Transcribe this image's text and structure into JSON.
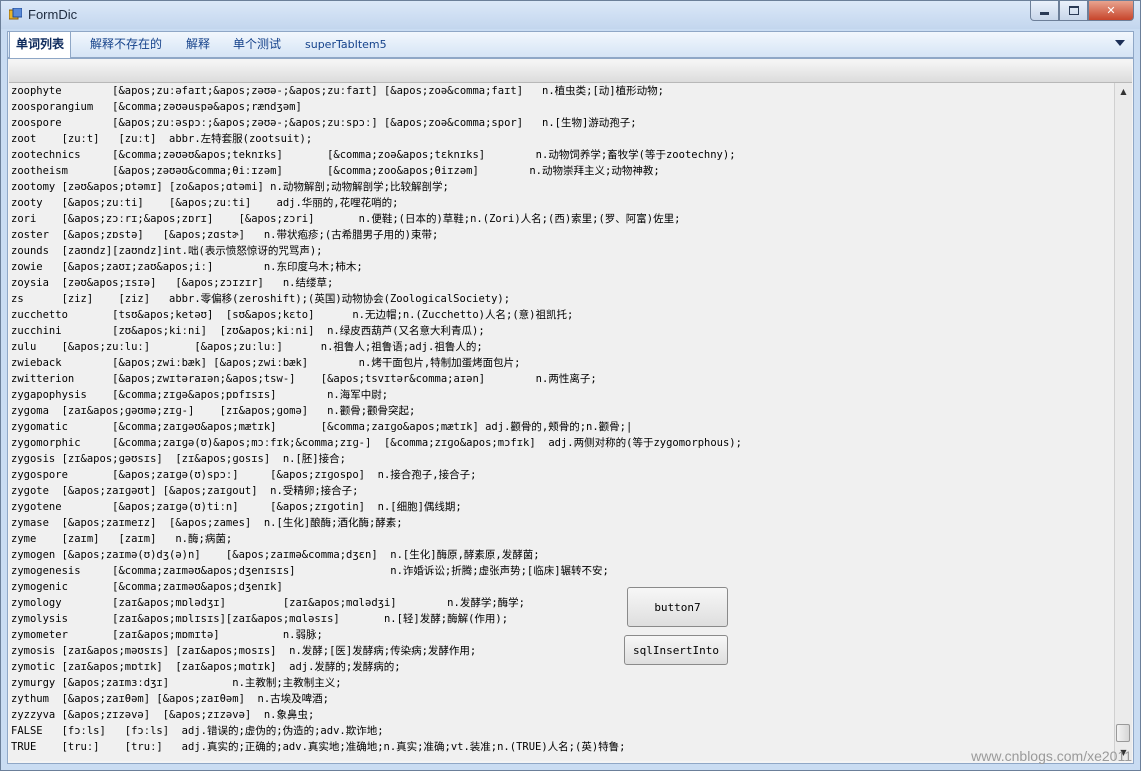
{
  "window": {
    "title": "FormDic"
  },
  "tabs": [
    {
      "label": "单词列表"
    },
    {
      "label": "解释不存在的"
    },
    {
      "label": "解释"
    },
    {
      "label": "单个测试"
    },
    {
      "label": "superTabItem5"
    }
  ],
  "lines": [
    "zoophyte        [&apos;zuːəfaɪt;&apos;zəʊə-;&apos;zuːfaɪt] [&apos;zoə&comma;faɪt]   n.植虫类;[动]植形动物;",
    "zoosporangium   [&comma;zəʊəuspə&apos;rændʒəm]",
    "zoospore        [&apos;zuːəspɔː;&apos;zəʊə-;&apos;zuːspɔː] [&apos;zoə&comma;spor]   n.[生物]游动孢子;",
    "zoot    [zuːt]   [zuːt]  abbr.左特套服(zootsuit);",
    "zootechnics     [&comma;zəʊəʊ&apos;teknɪks]       [&comma;zoə&apos;tɛknɪks]        n.动物饲养学;畜牧学(等于zootechny);",
    "zootheism       [&apos;zəʊəʊ&comma;θiːɪzəm]       [&comma;zoo&apos;θiɪzəm]        n.动物崇拜主义;动物神教;",
    "zootomy [zəʊ&apos;ɒtəmɪ] [zo&apos;ɑtəmi] n.动物解剖;动物解剖学;比较解剖学;",
    "zooty   [&apos;zuːti]    [&apos;zuːti]    adj.华丽的,花哩花哨的;",
    "zori    [&apos;zɔːrɪ;&apos;zɒrɪ]    [&apos;zɔri]       n.便鞋;(日本的)草鞋;n.(Zori)人名;(西)索里;(罗、阿富)佐里;",
    "zoster  [&apos;zɒstə]   [&apos;zɑstɚ]   n.带状疱疹;(古希腊男子用的)束带;",
    "zounds  [zaʊndz][zaʊndz]int.咄(表示愤怒惊讶的咒骂声);",
    "zowie   [&apos;zaʊɪ;zaʊ&apos;iː]        n.东印度乌木;柿木;",
    "zoysia  [zəʊ&apos;ɪsɪə]   [&apos;zɔɪzɪr]   n.结缕草;",
    "zs      [ziz]    [ziz]   abbr.零偏移(zeroshift);(英国)动物协会(ZoologicalSociety);",
    "zucchetto       [tsʊ&apos;ketəʊ]  [sʊ&apos;kɛto]      n.无边帽;n.(Zucchetto)人名;(意)祖凯托;",
    "zucchini        [zʊ&apos;kiːni]  [zʊ&apos;kiːni]  n.绿皮西葫芦(又名意大利青瓜);",
    "zulu    [&apos;zuːluː]       [&apos;zuːluː]      n.祖鲁人;祖鲁语;adj.祖鲁人的;",
    "zwieback        [&apos;zwiːbæk] [&apos;zwiːbæk]        n.烤干面包片,特制加蛋烤面包片;",
    "zwitterion      [&apos;zwɪtəraɪən;&apos;tsw-]    [&apos;tsvɪtər&comma;aɪən]        n.两性离子;",
    "zygapophysis    [&comma;zɪɡə&apos;pɒfɪsɪs]        n.海军中尉;",
    "zygoma  [zaɪ&apos;ɡəʊmə;zɪɡ-]    [zɪ&apos;ɡomə]   n.颧骨;颧骨突起;",
    "zygomatic       [&comma;zaɪɡəʊ&apos;mætɪk]       [&comma;zaɪɡo&apos;mætɪk] adj.颧骨的,颊骨的;n.颧骨;|",
    "zygomorphic     [&comma;zaɪɡə(ʊ)&apos;mɔːfɪk;&comma;zɪɡ-]  [&comma;zɪɡo&apos;mɔfɪk]  adj.两侧对称的(等于zygomorphous);",
    "zygosis [zɪ&apos;ɡəʊsɪs]  [zɪ&apos;ɡosɪs]  n.[胚]接合;",
    "zygospore       [&apos;zaɪɡə(ʊ)spɔː]     [&apos;zɪɡospo]  n.接合孢子,接合子;",
    "zygote  [&apos;zaɪɡəʊt] [&apos;zaɪɡout]  n.受精卵;接合子;",
    "zygotene        [&apos;zaɪɡə(ʊ)tiːn]     [&apos;zɪɡotin]  n.[细胞]偶线期;",
    "zymase  [&apos;zaɪmeɪz]  [&apos;zames]  n.[生化]酿酶;酒化酶;酵素;",
    "zyme    [zaɪm]   [zaɪm]   n.酶;病菌;",
    "zymogen [&apos;zaɪmə(ʊ)dʒ(ə)n]    [&apos;zaɪmə&comma;dʒɛn]  n.[生化]酶原,酵素原,发酵菌;",
    "zymogenesis     [&comma;zaɪməʊ&apos;dʒenɪsɪs]               n.诈婚诉讼;折腾;虚张声势;[临床]辗转不安;",
    "zymogenic       [&comma;zaɪməʊ&apos;dʒenɪk]",
    "zymology        [zaɪ&apos;mɒlədʒɪ]         [zaɪ&apos;mɑlədʒi]        n.发酵学;酶学;",
    "zymolysis       [zaɪ&apos;mɒlɪsɪs][zaɪ&apos;mɑləsɪs]       n.[轻]发酵;酶解(作用);",
    "zymometer       [zaɪ&apos;mɒmɪtə]          n.弱脉;",
    "zymosis [zaɪ&apos;məʊsɪs] [zaɪ&apos;mosɪs]  n.发酵;[医]发酵病;传染病;发酵作用;",
    "zymotic [zaɪ&apos;mɒtɪk]  [zaɪ&apos;mɑtɪk]  adj.发酵的;发酵病的;",
    "zymurgy [&apos;zaɪmɜːdʒɪ]          n.主教制;主教制主义;",
    "zythum  [&apos;zaɪθəm] [&apos;zaɪθəm]  n.古埃及啤酒;",
    "zyzzyva [&apos;zɪzəvə]  [&apos;zɪzəvə]  n.象鼻虫;",
    "FALSE   [fɔːls]   [fɔːls]  adj.错误的;虚伪的;伪造的;adv.欺诈地;",
    "TRUE    [truː]    [truː]   adj.真实的;正确的;adv.真实地;准确地;n.真实;准确;vt.装准;n.(TRUE)人名;(英)特鲁;"
  ],
  "buttons": {
    "button7": "button7",
    "sqlInsertInto": "sqlInsertInto"
  },
  "watermark": "www.cnblogs.com/xe2011"
}
